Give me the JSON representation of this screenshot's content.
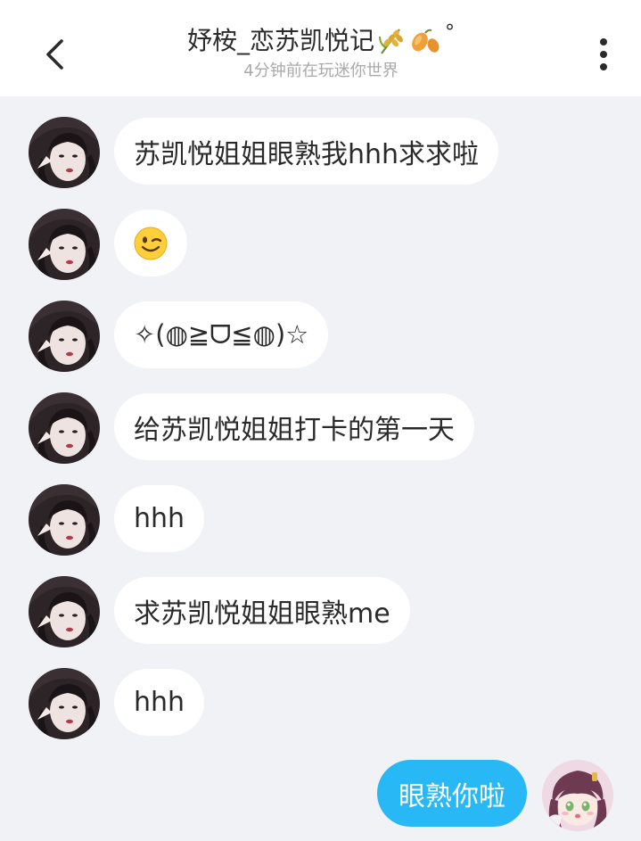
{
  "header": {
    "title": "妤桉_恋苏凯悦记",
    "title_suffix": "°",
    "subtitle": "4分钟前在玩迷你世界",
    "title_emoji_icons": [
      "rice-ear-icon",
      "sweet-potato-icon"
    ]
  },
  "messages": [
    {
      "sender": "other",
      "text": "苏凯悦姐姐眼熟我hhh求求啦"
    },
    {
      "sender": "other",
      "text": "😉"
    },
    {
      "sender": "other",
      "text": "✧(◍≧ᗜ≦◍)☆"
    },
    {
      "sender": "other",
      "text": "给苏凯悦姐姐打卡的第一天"
    },
    {
      "sender": "other",
      "text": "hhh"
    },
    {
      "sender": "other",
      "text": "求苏凯悦姐姐眼熟me"
    },
    {
      "sender": "other",
      "text": "hhh"
    },
    {
      "sender": "me",
      "text": "眼熟你啦"
    }
  ],
  "colors": {
    "background": "#f1f2f5",
    "header": "#ffffff",
    "other_bubble": "#ffffff",
    "my_bubble": "#28b8f5",
    "subtitle": "#a9a9a9"
  }
}
